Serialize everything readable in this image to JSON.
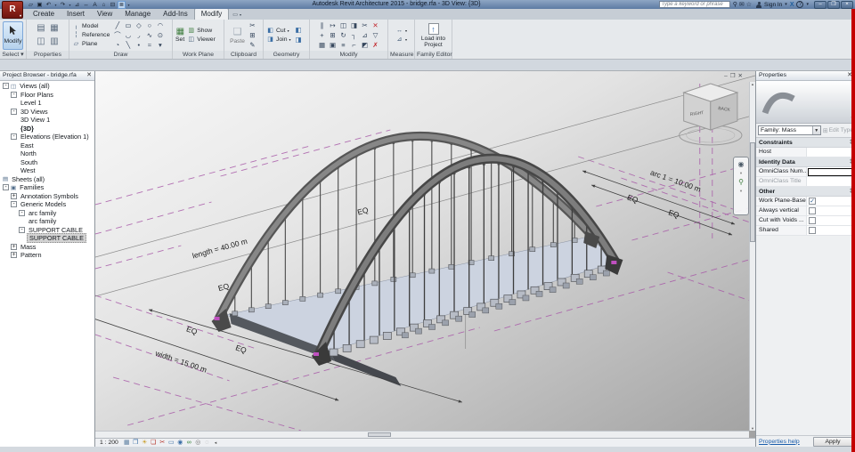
{
  "colors": {
    "titlebar": "#5d7ba3",
    "active_tab_bg": "#eef0f2",
    "modify_highlight": "#b6d2ec",
    "ref_plane_magenta": "#a85aa8",
    "deck": "#ccd3e0",
    "arch_gray": "#6f6f6f",
    "red_edge": "#c40000",
    "link_blue": "#1a5dab"
  },
  "titlebar": {
    "app_title": "Autodesk Revit Architecture 2015 -",
    "doc_title": "bridge.rfa - 3D View: {3D}",
    "search_placeholder": "Type a keyword or phrase",
    "sign_in": "Sign In",
    "window_buttons": [
      {
        "name": "minimize",
        "glyph": "–"
      },
      {
        "name": "restore",
        "glyph": "❒"
      },
      {
        "name": "close",
        "glyph": "×"
      }
    ],
    "qat_icons": [
      {
        "name": "open",
        "glyph": "▱"
      },
      {
        "name": "save",
        "glyph": "▣"
      },
      {
        "name": "undo",
        "glyph": "↶"
      },
      {
        "name": "undo-drop",
        "glyph": "▾"
      },
      {
        "name": "redo",
        "glyph": "↷"
      },
      {
        "name": "redo-drop",
        "glyph": "▾"
      },
      {
        "name": "measure",
        "glyph": "⊿"
      },
      {
        "name": "aligned-dimension",
        "glyph": "↔"
      },
      {
        "name": "text",
        "glyph": "A"
      },
      {
        "name": "default-3d-view",
        "glyph": "⌂"
      },
      {
        "name": "section",
        "glyph": "⊟"
      },
      {
        "name": "thin-lines",
        "glyph": "≣",
        "highlight": true
      },
      {
        "name": "customize-qat",
        "glyph": "▾"
      }
    ],
    "infocenter_icons": [
      {
        "name": "search",
        "glyph": "⚲"
      },
      {
        "name": "communication-center",
        "glyph": "✉"
      },
      {
        "name": "favorites",
        "glyph": "☆"
      }
    ],
    "exchange_label": "X",
    "help_label": "?"
  },
  "tabs": {
    "items": [
      "Create",
      "Insert",
      "View",
      "Manage",
      "Add-Ins",
      "Modify"
    ],
    "active": "Modify"
  },
  "ribbon": {
    "select": {
      "button_label": "Modify",
      "panel_label": "Select"
    },
    "properties": {
      "panel_label": "Properties",
      "icons": [
        {
          "name": "family-category",
          "glyph": "▤"
        },
        {
          "name": "family-types",
          "glyph": "▦"
        },
        {
          "name": "properties-palette",
          "glyph": "◫"
        },
        {
          "name": "family-parameters",
          "glyph": "▥"
        }
      ]
    },
    "draw": {
      "panel_label": "Draw",
      "model": "Model",
      "reference": "Reference",
      "plane": "Plane",
      "tools": [
        {
          "name": "line",
          "glyph": "╱"
        },
        {
          "name": "rectangle",
          "glyph": "▭"
        },
        {
          "name": "polygon",
          "glyph": "◇"
        },
        {
          "name": "circle",
          "glyph": "○"
        },
        {
          "name": "start-end-radius-arc",
          "glyph": "◠"
        },
        {
          "name": "center-ends-arc",
          "glyph": "⌒"
        },
        {
          "name": "tangent-arc",
          "glyph": "◡"
        },
        {
          "name": "fillet-arc",
          "glyph": "◞"
        },
        {
          "name": "spline",
          "glyph": "∿"
        },
        {
          "name": "ellipse",
          "glyph": "⊙"
        },
        {
          "name": "partial-ellipse",
          "glyph": "◔"
        },
        {
          "name": "pick-lines",
          "glyph": "╲"
        },
        {
          "name": "point",
          "glyph": "•"
        },
        {
          "name": "spline-through-points",
          "glyph": "≈"
        },
        {
          "name": "more-draw",
          "glyph": "▾"
        }
      ]
    },
    "work_plane": {
      "panel_label": "Work Plane",
      "set": "Set",
      "show": "Show",
      "viewer": "Viewer"
    },
    "clipboard": {
      "panel_label": "Clipboard",
      "paste": "Paste",
      "side_icons": [
        {
          "name": "cut-clipboard",
          "glyph": "✂"
        },
        {
          "name": "copy-clipboard",
          "glyph": "⊞"
        },
        {
          "name": "match-type",
          "glyph": "✎"
        }
      ]
    },
    "geometry": {
      "panel_label": "Geometry",
      "cut": "Cut",
      "join": "Join",
      "side_icons": [
        {
          "name": "cut-geometry-icon",
          "glyph": "◧"
        },
        {
          "name": "join-geometry-icon",
          "glyph": "◨"
        }
      ]
    },
    "modify": {
      "panel_label": "Modify",
      "tools": [
        {
          "name": "align",
          "glyph": "∥"
        },
        {
          "name": "offset",
          "glyph": "↦"
        },
        {
          "name": "mirror-axis",
          "glyph": "◫"
        },
        {
          "name": "mirror-pick",
          "glyph": "◨"
        },
        {
          "name": "split",
          "glyph": "✂"
        },
        {
          "name": "delete",
          "glyph": "✕",
          "color": "#c1272d"
        },
        {
          "name": "move",
          "glyph": "+"
        },
        {
          "name": "copy",
          "glyph": "⊞"
        },
        {
          "name": "rotate",
          "glyph": "↻"
        },
        {
          "name": "trim",
          "glyph": "┐"
        },
        {
          "name": "scale",
          "glyph": "⊿"
        },
        {
          "name": "pin",
          "glyph": "▽"
        },
        {
          "name": "array",
          "glyph": "▦"
        },
        {
          "name": "group",
          "glyph": "▣"
        },
        {
          "name": "match",
          "glyph": "≡"
        },
        {
          "name": "join-2",
          "glyph": "⌐"
        },
        {
          "name": "paint",
          "glyph": "◩"
        },
        {
          "name": "unpin",
          "glyph": "✗",
          "color": "#c1272d"
        }
      ]
    },
    "measure": {
      "panel_label": "Measure",
      "icons": [
        {
          "name": "measure-between-refs",
          "glyph": "↔"
        },
        {
          "name": "measure-along-element",
          "glyph": "⊿"
        }
      ]
    },
    "family_editor": {
      "panel_label": "Family Editor",
      "load": "Load into Project"
    }
  },
  "project_browser": {
    "title": "Project Browser - bridge.rfa",
    "items": [
      {
        "label": "Views (all)",
        "depth": 0,
        "glyph": "-",
        "icon": "views"
      },
      {
        "label": "Floor Plans",
        "depth": 1,
        "glyph": "-"
      },
      {
        "label": "Level 1",
        "depth": 2
      },
      {
        "label": "3D Views",
        "depth": 1,
        "glyph": "-"
      },
      {
        "label": "3D View 1",
        "depth": 2
      },
      {
        "label": "{3D}",
        "depth": 2,
        "bold": true
      },
      {
        "label": "Elevations (Elevation 1)",
        "depth": 1,
        "glyph": "-"
      },
      {
        "label": "East",
        "depth": 2
      },
      {
        "label": "North",
        "depth": 2
      },
      {
        "label": "South",
        "depth": 2
      },
      {
        "label": "West",
        "depth": 2
      },
      {
        "label": "Sheets (all)",
        "depth": 0,
        "icon": "sheets"
      },
      {
        "label": "Families",
        "depth": 0,
        "glyph": "-",
        "icon": "families"
      },
      {
        "label": "Annotation Symbols",
        "depth": 1,
        "glyph": "+"
      },
      {
        "label": "Generic Models",
        "depth": 1,
        "glyph": "-"
      },
      {
        "label": "arc family",
        "depth": 2,
        "glyph": "-"
      },
      {
        "label": "arc family",
        "depth": 3
      },
      {
        "label": "SUPPORT CABLE",
        "depth": 2,
        "glyph": "-"
      },
      {
        "label": "SUPPORT CABLE",
        "depth": 3,
        "selected": true
      },
      {
        "label": "Mass",
        "depth": 1,
        "glyph": "+"
      },
      {
        "label": "Pattern",
        "depth": 1,
        "glyph": "+"
      }
    ]
  },
  "viewport": {
    "annotations": {
      "length": "length = 40.00 m",
      "arc": "arc 1 = 10.00 m",
      "width": "width = 15.00 m",
      "eq": "EQ"
    },
    "viewcube": {
      "right": "RIGHT",
      "back": "BACK"
    },
    "scale": "1 : 200",
    "window_controls": [
      {
        "name": "viewport-minimize",
        "glyph": "–"
      },
      {
        "name": "viewport-restore",
        "glyph": "❐"
      },
      {
        "name": "viewport-close",
        "glyph": "✕"
      }
    ],
    "viewbar_icons": [
      {
        "name": "detail-level",
        "glyph": "▦",
        "color": "#5b7da0"
      },
      {
        "name": "visual-style",
        "glyph": "❒",
        "color": "#3a6ea5"
      },
      {
        "name": "sun-path",
        "glyph": "☀",
        "color": "#c79a1e"
      },
      {
        "name": "shadows",
        "glyph": "❏",
        "color": "#b5342a"
      },
      {
        "name": "crop-view",
        "glyph": "✂",
        "color": "#b5342a"
      },
      {
        "name": "show-crop-region",
        "glyph": "▭",
        "color": "#3a6ea5"
      },
      {
        "name": "unlocked-3d-view",
        "glyph": "◉",
        "color": "#3a6ea5"
      },
      {
        "name": "temporary-hide-isolate",
        "glyph": "∞",
        "color": "#2e7d32"
      },
      {
        "name": "reveal-hidden-elements",
        "glyph": "◎",
        "color": "#777777"
      },
      {
        "name": "analysis-display",
        "glyph": "◌",
        "color": "#999999"
      }
    ]
  },
  "properties_panel": {
    "title": "Properties",
    "family_selector": "Family: Mass",
    "edit_type": "Edit Type",
    "sections": [
      {
        "header": "Constraints",
        "rows": [
          {
            "label": "Host",
            "type": "text",
            "value": ""
          }
        ]
      },
      {
        "header": "Identity Data",
        "rows": [
          {
            "label": "OmniClass Num...",
            "type": "input",
            "value": ""
          },
          {
            "label": "OmniClass Title",
            "type": "text",
            "value": "",
            "muted": true
          }
        ]
      },
      {
        "header": "Other",
        "rows": [
          {
            "label": "Work Plane-Based",
            "type": "checkbox",
            "checked": true
          },
          {
            "label": "Always vertical",
            "type": "checkbox",
            "checked": false
          },
          {
            "label": "Cut with Voids ...",
            "type": "checkbox",
            "checked": false
          },
          {
            "label": "Shared",
            "type": "checkbox",
            "checked": false
          }
        ]
      }
    ],
    "help_link": "Properties help",
    "apply": "Apply"
  }
}
